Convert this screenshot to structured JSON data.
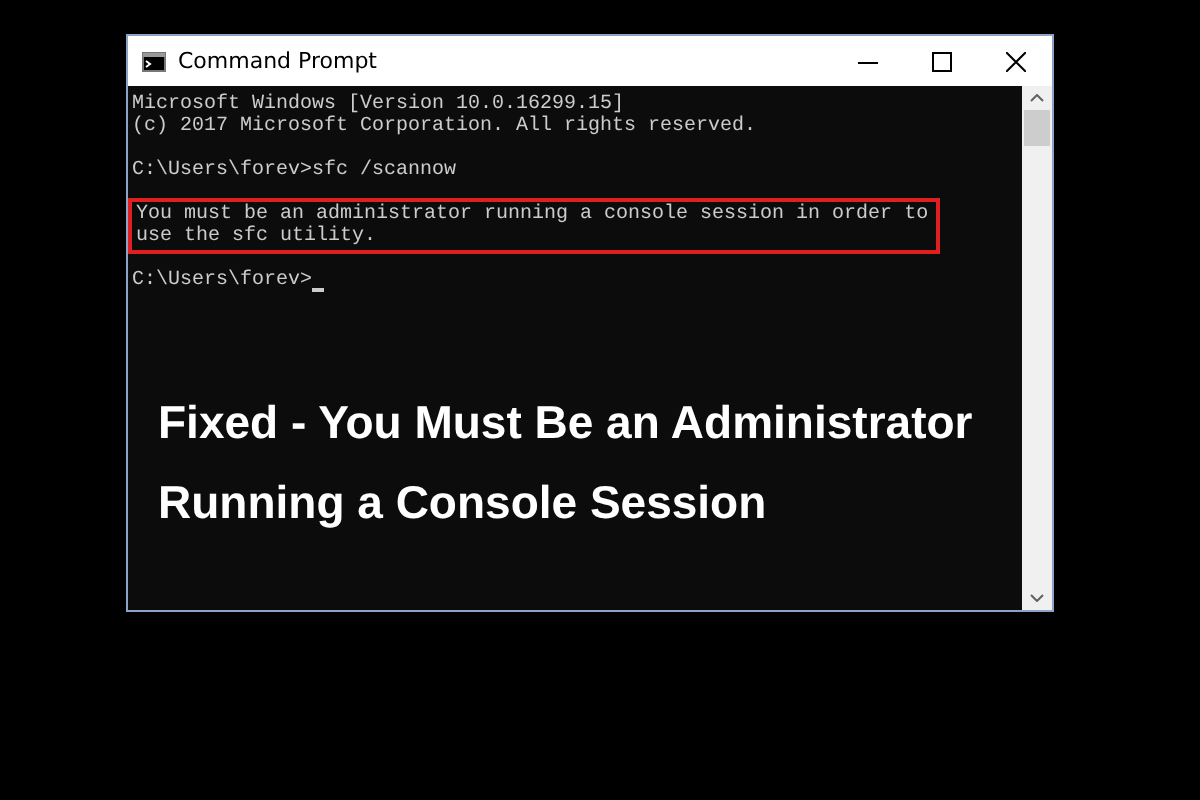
{
  "window": {
    "title": "Command Prompt"
  },
  "console": {
    "blocks": [
      {
        "kind": "output",
        "lines": [
          "Microsoft Windows [Version 10.0.16299.15]",
          "(c) 2017 Microsoft Corporation. All rights reserved."
        ]
      },
      {
        "kind": "output",
        "lines": [
          "C:\\Users\\forev>sfc /scannow"
        ]
      },
      {
        "kind": "boxed",
        "lines": [
          "You must be an administrator running a console session in order to",
          "use the sfc utility."
        ]
      },
      {
        "kind": "prompt",
        "lines": [
          "C:\\Users\\forev>"
        ],
        "cursor": true
      }
    ]
  },
  "headline": [
    "Fixed - You Must Be an Administrator",
    "Running a Console Session"
  ]
}
